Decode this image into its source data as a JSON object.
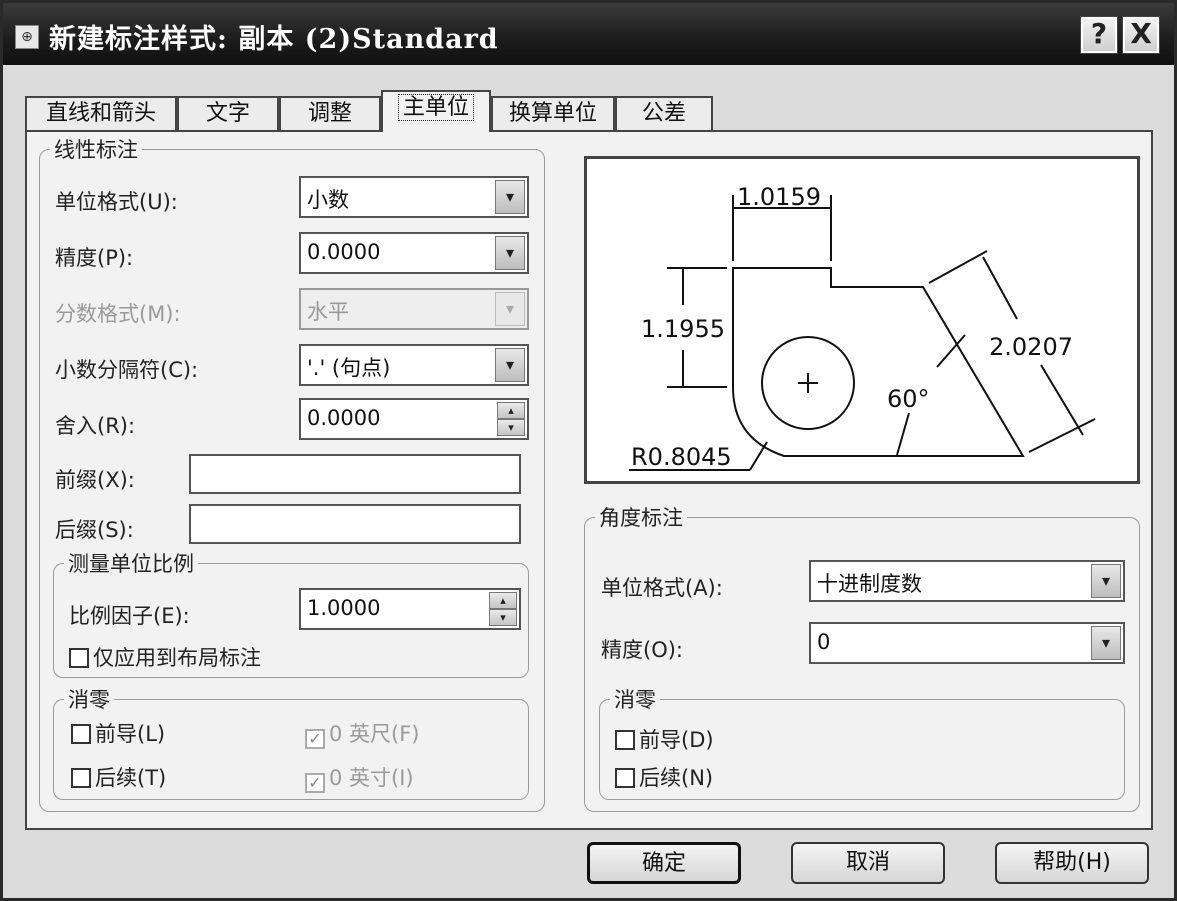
{
  "window": {
    "title": "新建标注样式: 副本 (2)Standard",
    "help_label": "?",
    "close_label": "X"
  },
  "tabs": [
    {
      "label": "直线和箭头"
    },
    {
      "label": "文字"
    },
    {
      "label": "调整"
    },
    {
      "label": "主单位",
      "active": true
    },
    {
      "label": "换算单位"
    },
    {
      "label": "公差"
    }
  ],
  "linear": {
    "title": "线性标注",
    "unit_format_label": "单位格式(U):",
    "unit_format_value": "小数",
    "precision_label": "精度(P):",
    "precision_value": "0.0000",
    "fraction_format_label": "分数格式(M):",
    "fraction_format_value": "水平",
    "decimal_separator_label": "小数分隔符(C):",
    "decimal_separator_value": "'.' (句点)",
    "round_off_label": "舍入(R):",
    "round_off_value": "0.0000",
    "prefix_label": "前缀(X):",
    "prefix_value": "",
    "suffix_label": "后缀(S):",
    "suffix_value": "",
    "scale": {
      "title": "测量单位比例",
      "factor_label": "比例因子(E):",
      "factor_value": "1.0000",
      "layout_only_label": "仅应用到布局标注",
      "layout_only_checked": false
    },
    "zero_suppression": {
      "title": "消零",
      "leading_label": "前导(L)",
      "leading_checked": false,
      "trailing_label": "后续(T)",
      "trailing_checked": false,
      "feet_label": "0 英尺(F)",
      "feet_checked": true,
      "inches_label": "0 英寸(I)",
      "inches_checked": true
    }
  },
  "preview": {
    "dim_top": "1.0159",
    "dim_left": "1.1955",
    "dim_right": "2.0207",
    "angle": "60°",
    "radius": "R0.8045",
    "center_mark": "+"
  },
  "angular": {
    "title": "角度标注",
    "unit_format_label": "单位格式(A):",
    "unit_format_value": "十进制度数",
    "precision_label": "精度(O):",
    "precision_value": "0",
    "zero_suppression": {
      "title": "消零",
      "leading_label": "前导(D)",
      "leading_checked": false,
      "trailing_label": "后续(N)",
      "trailing_checked": false
    }
  },
  "buttons": {
    "ok": "确定",
    "cancel": "取消",
    "help": "帮助(H)"
  },
  "icons": {
    "dropdown": "▾",
    "spin_up": "▴",
    "spin_down": "▾",
    "check": "✓",
    "title_icon": "⊕"
  }
}
